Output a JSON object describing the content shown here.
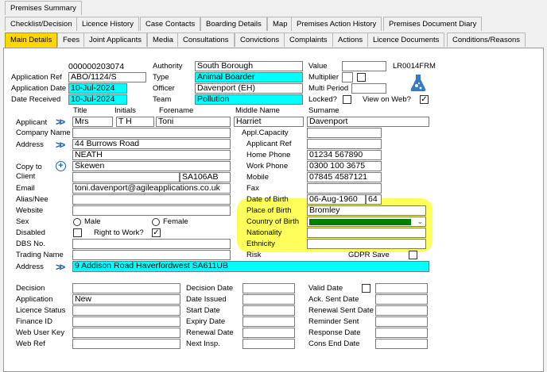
{
  "tabs_row1": [
    "Premises Summary"
  ],
  "tabs_row2": [
    "Checklist/Decision",
    "Licence History",
    "Case Contacts",
    "Boarding Details",
    "Map",
    "Premises Action History",
    "Premises Document Diary"
  ],
  "tabs_row3": [
    "Main Details",
    "Fees",
    "Joint Applicants",
    "Media",
    "Consultations",
    "Convictions",
    "Complaints",
    "Actions",
    "Licence Documents",
    "Conditions/Reasons"
  ],
  "application": {
    "number": "000000203074",
    "ref_label": "Application Ref",
    "ref": "ABO/1124/S",
    "date_label": "Application Date",
    "date": "10-Jul-2024",
    "received_label": "Date Received",
    "received": "10-Jul-2024"
  },
  "authority": {
    "label": "Authority",
    "value": "South Borough",
    "type_label": "Type",
    "type": "Animal Boarder",
    "officer_label": "Officer",
    "officer": "Davenport (EH)",
    "team_label": "Team",
    "team": "Pollution"
  },
  "right_top": {
    "value_label": "Value",
    "value": "",
    "form_code": "LR0014FRM",
    "multiplier_label": "Multiplier",
    "multi_period_label": "Multi Period",
    "locked_label": "Locked?",
    "view_web_label": "View on Web?",
    "view_web_checked": "✓"
  },
  "applicant": {
    "title_hdr": "Title",
    "initials_hdr": "Initials",
    "forename_hdr": "Forename",
    "middle_hdr": "Middle Name",
    "surname_hdr": "Surname",
    "label": "Applicant",
    "title": "Mrs",
    "initials": "T H",
    "forename": "Toni",
    "middle": "Harriet",
    "surname": "Davenport"
  },
  "left_fields": {
    "company_label": "Company Name",
    "address_label": "Address",
    "addr1": "44 Burrows Road",
    "addr2": "NEATH",
    "addr3": "Skewen",
    "postcode": "SA106AB",
    "copy_label": "Copy to",
    "client_label": "Client",
    "email_label": "Email",
    "email": "toni.davenport@agileapplications.co.uk",
    "alias_label": "Alias/Nee",
    "website_label": "Website",
    "sex_label": "Sex",
    "male": "Male",
    "female": "Female",
    "disabled_label": "Disabled",
    "right_work_label": "Right to Work?",
    "right_work_checked": "✓",
    "dbs_label": "DBS No.",
    "trading_label": "Trading Name",
    "trading_address_label": "Address",
    "trading_address": "9 Addison Road Haverfordwest SA611UB"
  },
  "right_fields": {
    "capacity_label": "Appl.Capacity",
    "appref_label": "Applicant Ref",
    "home_label": "Home Phone",
    "home": "01234 567890",
    "work_label": "Work Phone",
    "work": "0300 100 3675",
    "mobile_label": "Mobile",
    "mobile": "07845 4587121",
    "fax_label": "Fax",
    "dob_label": "Date of Birth",
    "dob": "06-Aug-1960",
    "age": "64",
    "pob_label": "Place of Birth",
    "pob": "Bromley",
    "cob_label": "Country of Birth",
    "nationality_label": "Nationality",
    "ethnicity_label": "Ethnicity",
    "risk_label": "Risk",
    "gdpr_label": "GDPR Save"
  },
  "bottom": {
    "decision_label": "Decision",
    "application_label": "Application",
    "application": "New",
    "licence_status_label": "Licence Status",
    "finance_label": "Finance ID",
    "web_key_label": "Web User Key",
    "web_ref_label": "Web Ref",
    "decision_date": "Decision Date",
    "date_issued": "Date Issued",
    "start_date": "Start Date",
    "expiry_date": "Expiry Date",
    "renewal_date": "Renewal Date",
    "next_insp": "Next Insp.",
    "valid_date": "Valid Date",
    "ack_sent": "Ack. Sent Date",
    "renewal_sent": "Renewal Sent Date",
    "reminder_sent": "Reminder Sent",
    "response_date": "Response Date",
    "cons_end": "Cons End Date"
  },
  "colors": {
    "highlight": "#ffff40",
    "cyan": "#00ffff",
    "active_tab": "#ffd700",
    "country_fill": "#008000"
  }
}
